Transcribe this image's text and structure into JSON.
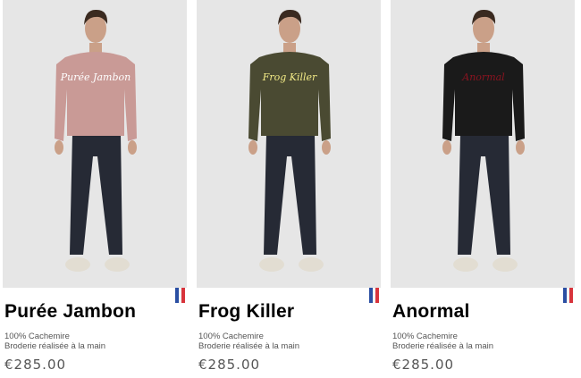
{
  "products": [
    {
      "name": "Purée Jambon",
      "material": "100% Cachemire",
      "detail": "Broderie réalisée à la main",
      "price": "€285.00",
      "origin_icon": "french-flag-icon",
      "sweater_color": "#c99a96",
      "embroidery_text": "Purée Jambon",
      "embroidery_color": "#ffffff"
    },
    {
      "name": "Frog Killer",
      "material": "100% Cachemire",
      "detail": "Broderie réalisée à la main",
      "price": "€285.00",
      "origin_icon": "french-flag-icon",
      "sweater_color": "#4a4a32",
      "embroidery_text": "Frog Killer",
      "embroidery_color": "#f2ea86"
    },
    {
      "name": "Anormal",
      "material": "100% Cachemire",
      "detail": "Broderie réalisée à la main",
      "price": "€285.00",
      "origin_icon": "french-flag-icon",
      "sweater_color": "#1a1a1a",
      "embroidery_text": "Anormal",
      "embroidery_color": "#8a1420"
    }
  ],
  "colors": {
    "photo_background": "#e6e6e6",
    "jeans": "#262a35",
    "price_text": "#555555"
  }
}
